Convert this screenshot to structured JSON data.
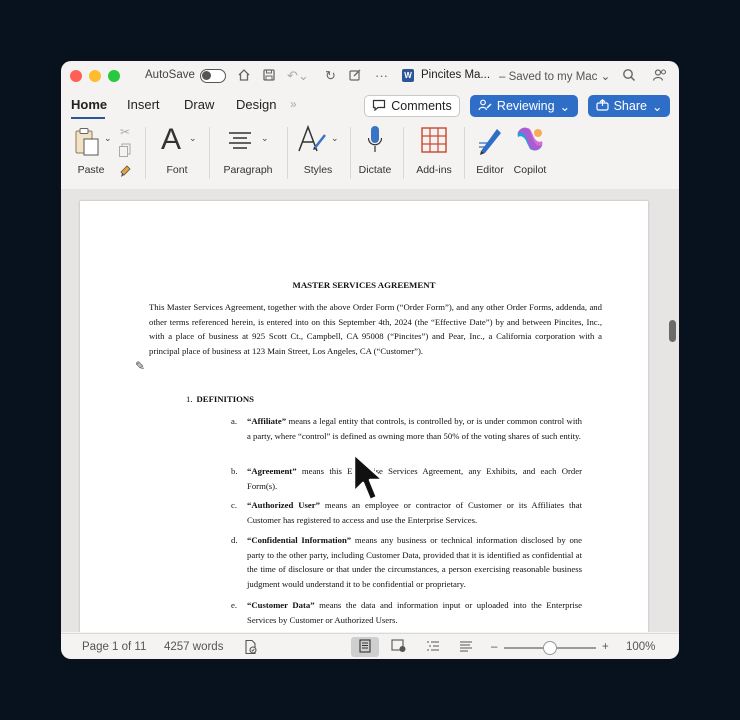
{
  "titlebar": {
    "autosave_label": "AutoSave",
    "doc_title": "Pincites Ma...",
    "saved_status": "– Saved to my Mac ⌄"
  },
  "tabs": [
    {
      "label": "Home",
      "active": true
    },
    {
      "label": "Insert"
    },
    {
      "label": "Draw"
    },
    {
      "label": "Design"
    }
  ],
  "actions": {
    "comments": "Comments",
    "reviewing": "Reviewing",
    "share": "Share"
  },
  "ribbon": {
    "paste": "Paste",
    "font": "Font",
    "paragraph": "Paragraph",
    "styles": "Styles",
    "dictate": "Dictate",
    "addins": "Add-ins",
    "editor": "Editor",
    "copilot": "Copilot"
  },
  "document": {
    "title": "MASTER SERVICES AGREEMENT",
    "intro": "This Master Services Agreement, together with the above Order Form (“Order Form”), and any other Order Forms, addenda, and other terms referenced herein, is entered into on this September 4th, 2024 (the “Effective Date”) by and between Pincites, Inc., with a place of business at 925 Scott Ct., Campbell, CA 95008 (“Pincites”) and Pear, Inc., a California corporation with a principal place of business at 123 Main Street, Los Angeles, CA (“Customer”).",
    "section": {
      "number": "1.",
      "heading": "DEFINITIONS"
    },
    "definitions": [
      {
        "letter": "a.",
        "term": "“Affiliate”",
        "text": " means a legal entity that controls, is controlled by, or is under common control with a party, where “control” is defined as owning more than 50% of the voting shares of such entity."
      },
      {
        "letter": "b.",
        "term": "“Agreement”",
        "text": " means this Enterprise Services Agreement, any Exhibits, and each Order Form(s)."
      },
      {
        "letter": "c.",
        "term": "“Authorized User”",
        "text": " means an employee or contractor of Customer or its Affiliates that Customer has registered to access and use the Enterprise Services."
      },
      {
        "letter": "d.",
        "term": "“Confidential Information”",
        "text": " means any business or technical information disclosed by one party to the other party, including Customer Data, provided that it is identified as confidential at the time of disclosure or that under the circumstances, a person exercising reasonable business judgment would understand it to be confidential or proprietary."
      },
      {
        "letter": "e.",
        "term": "“Customer Data”",
        "text": " means the data and information input or uploaded into the Enterprise Services by Customer or Authorized Users."
      }
    ]
  },
  "status": {
    "page": "Page 1 of 11",
    "words": "4257 words",
    "zoom": "100%",
    "zoom_minus": "–",
    "zoom_plus": "+"
  },
  "colors": {
    "accent": "#2f6ec7",
    "close": "#ff5f57",
    "minimize": "#febc2e",
    "zoom": "#28c840"
  },
  "icons": [
    "home-icon",
    "save-icon",
    "undo-icon",
    "redo-icon",
    "more-icon",
    "search-icon",
    "share-people-icon",
    "comment-icon",
    "pencil-icon",
    "upload-icon",
    "paste-icon",
    "cut-icon",
    "copy-icon",
    "format-painter-icon",
    "font-icon",
    "paragraph-icon",
    "styles-icon",
    "microphone-icon",
    "addins-icon",
    "editor-icon",
    "copilot-icon",
    "accessibility-icon",
    "print-layout-icon",
    "web-layout-icon",
    "outline-icon",
    "draft-icon",
    "pointer-cursor-icon"
  ]
}
